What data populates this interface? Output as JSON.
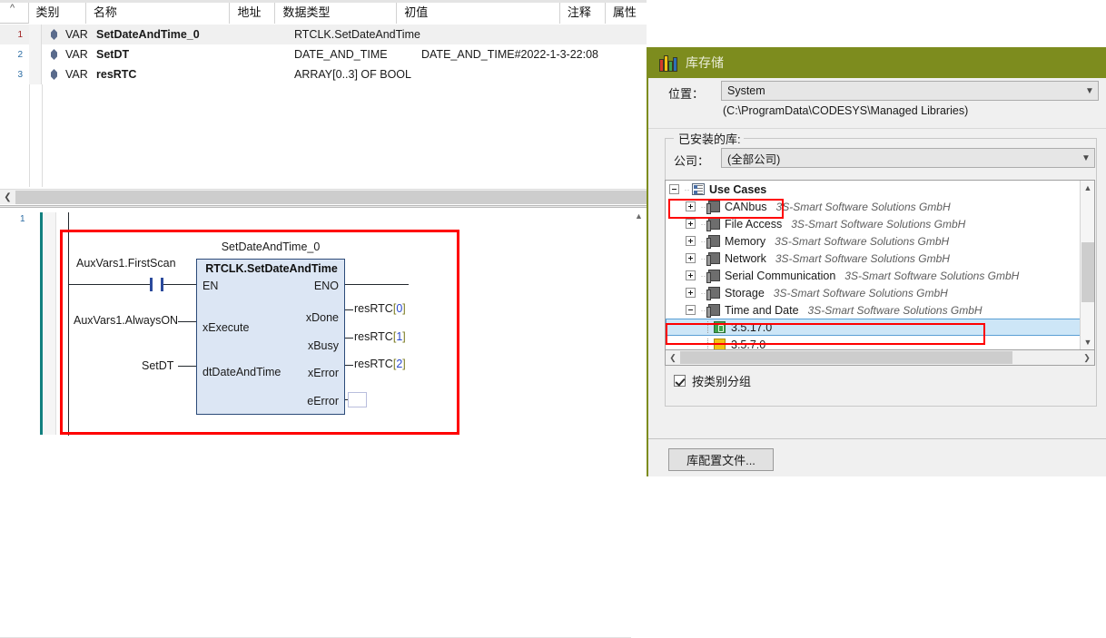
{
  "declaration": {
    "columns": [
      "类别",
      "名称",
      "地址",
      "数据类型",
      "初值",
      "注释",
      "属性"
    ],
    "rows": [
      {
        "num": "1",
        "scope": "VAR",
        "name": "SetDateAndTime_0",
        "address": "",
        "datatype": "RTCLK.SetDateAndTime",
        "initial": "",
        "comment": "",
        "attributes": ""
      },
      {
        "num": "2",
        "scope": "VAR",
        "name": "SetDT",
        "address": "",
        "datatype": "DATE_AND_TIME",
        "initial": "DATE_AND_TIME#2022-1-3-22:08",
        "comment": "",
        "attributes": ""
      },
      {
        "num": "3",
        "scope": "VAR",
        "name": "resRTC",
        "address": "",
        "datatype": "ARRAY[0..3] OF BOOL",
        "initial": "",
        "comment": "",
        "attributes": ""
      }
    ]
  },
  "fbd": {
    "network_number": "1",
    "instance_name": "SetDateAndTime_0",
    "block_type": "RTCLK.SetDateAndTime",
    "inputs": [
      {
        "pin": "EN",
        "operand": "AuxVars1.FirstScan",
        "style": "contact"
      },
      {
        "pin": "xExecute",
        "operand": "AuxVars1.AlwaysON",
        "style": "wire"
      },
      {
        "pin": "dtDateAndTime",
        "operand": "SetDT",
        "style": "wire"
      }
    ],
    "outputs": [
      {
        "pin": "ENO",
        "operand": "",
        "base": "",
        "index": ""
      },
      {
        "pin": "xDone",
        "operand": "resRTC[0]",
        "base": "resRTC",
        "index": "0"
      },
      {
        "pin": "xBusy",
        "operand": "resRTC[1]",
        "base": "resRTC",
        "index": "1"
      },
      {
        "pin": "xError",
        "operand": "resRTC[2]",
        "base": "resRTC",
        "index": "2"
      },
      {
        "pin": "eError",
        "operand": "",
        "base": "",
        "index": ""
      }
    ]
  },
  "dialog": {
    "title": "库存储",
    "location_label": "位置：",
    "location_value": "System",
    "location_path": "(C:\\ProgramData\\CODESYS\\Managed Libraries)",
    "group_legend": "已安装的库:",
    "company_label": "公司：",
    "company_value": "(全部公司)",
    "tree": [
      {
        "level": 0,
        "label": "Use Cases",
        "vendor": "",
        "expander": "minus",
        "icon": "use-cases-icon",
        "bold": true,
        "selected": false
      },
      {
        "level": 1,
        "label": "CANbus",
        "vendor": "3S-Smart Software Solutions GmbH",
        "expander": "plus",
        "icon": "library-folder-icon",
        "bold": false,
        "selected": false
      },
      {
        "level": 1,
        "label": "File Access",
        "vendor": "3S-Smart Software Solutions GmbH",
        "expander": "plus",
        "icon": "library-folder-icon",
        "bold": false,
        "selected": false
      },
      {
        "level": 1,
        "label": "Memory",
        "vendor": "3S-Smart Software Solutions GmbH",
        "expander": "plus",
        "icon": "library-folder-icon",
        "bold": false,
        "selected": false
      },
      {
        "level": 1,
        "label": "Network",
        "vendor": "3S-Smart Software Solutions GmbH",
        "expander": "plus",
        "icon": "library-folder-icon",
        "bold": false,
        "selected": false
      },
      {
        "level": 1,
        "label": "Serial Communication",
        "vendor": "3S-Smart Software Solutions GmbH",
        "expander": "plus",
        "icon": "library-folder-icon",
        "bold": false,
        "selected": false
      },
      {
        "level": 1,
        "label": "Storage",
        "vendor": "3S-Smart Software Solutions GmbH",
        "expander": "plus",
        "icon": "library-folder-icon",
        "bold": false,
        "selected": false
      },
      {
        "level": 1,
        "label": "Time and Date",
        "vendor": "3S-Smart Software Solutions GmbH",
        "expander": "minus",
        "icon": "library-folder-icon",
        "bold": false,
        "selected": false
      },
      {
        "level": 2,
        "label": "3.5.17.0",
        "vendor": "",
        "expander": "none",
        "icon": "signed-library-icon",
        "bold": false,
        "selected": true
      },
      {
        "level": 2,
        "label": "3.5.7.0",
        "vendor": "",
        "expander": "none",
        "icon": "library-version-icon",
        "bold": false,
        "selected": false
      }
    ],
    "group_by_category_label": "按类别分组",
    "group_by_category_checked": true,
    "library_profiles_button": "库配置文件..."
  },
  "colors": {
    "dialog_title_bg": "#7d8c1e",
    "block_fill": "#dce6f4",
    "block_border": "#2b4a78",
    "annotation_red": "#ff0000",
    "selection_blue": "#cde6f7",
    "network_marker": "#12807f"
  }
}
